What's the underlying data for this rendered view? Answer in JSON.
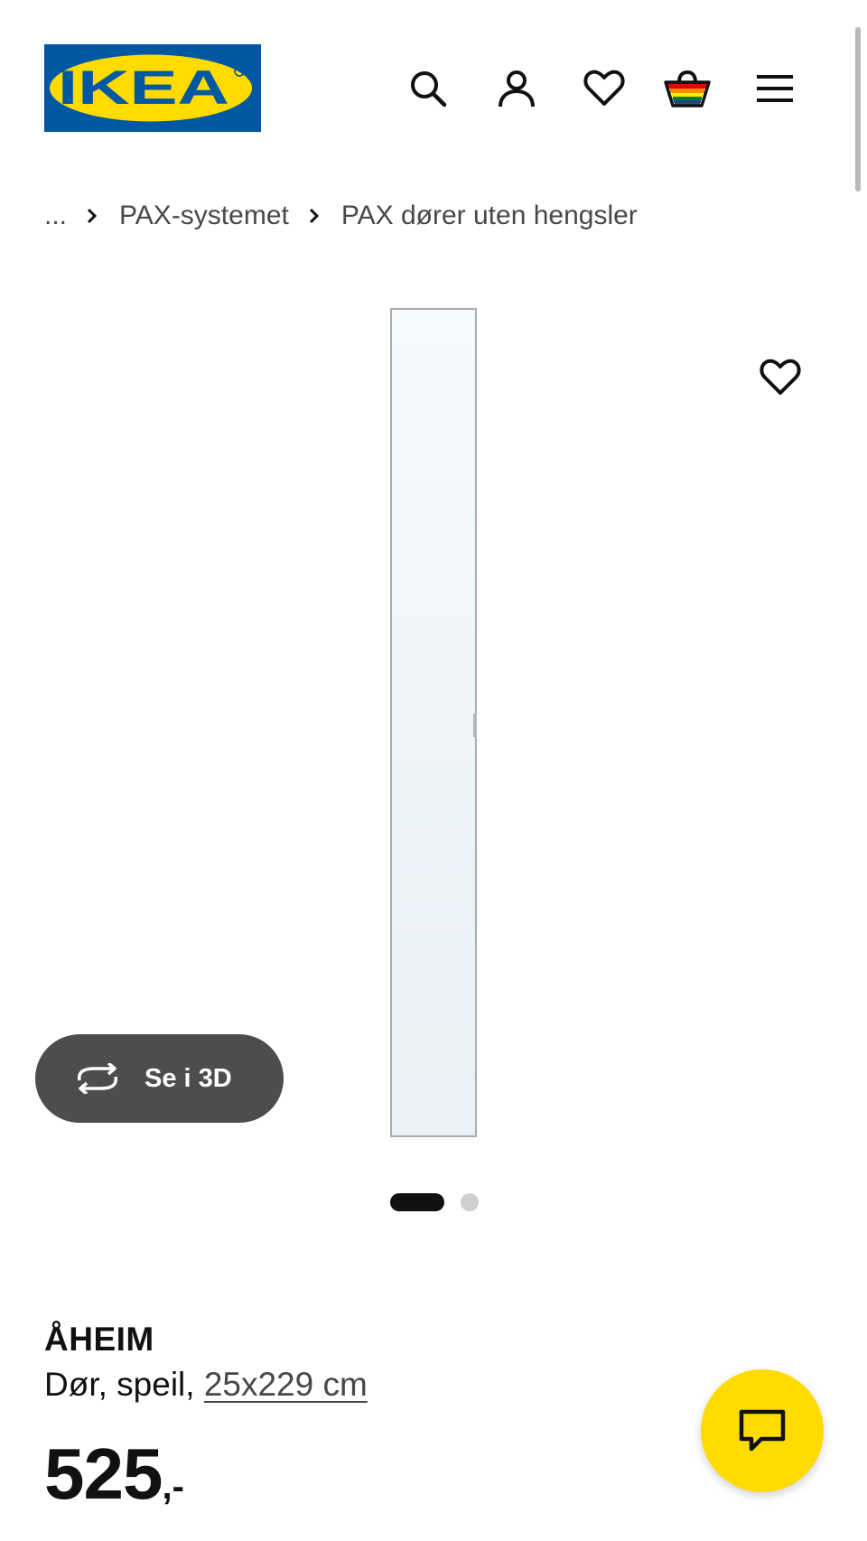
{
  "header": {
    "logo_text": "IKEA",
    "logo_colors": {
      "background": "#0058a3",
      "oval": "#ffdb00"
    },
    "icons": [
      "search-icon",
      "account-icon",
      "heart-icon",
      "basket-icon",
      "menu-icon"
    ]
  },
  "breadcrumb": {
    "ellipsis": "...",
    "items": [
      "PAX-systemet",
      "PAX dører uten hengsler"
    ]
  },
  "gallery": {
    "view_3d_label": "Se i 3D",
    "slide_count": 2,
    "active_slide": 1
  },
  "product": {
    "name": "ÅHEIM",
    "description": "Dør, speil, ",
    "size": "25x229 cm",
    "price_integer": "525",
    "price_suffix": ",-"
  },
  "colors": {
    "accent_yellow": "#ffdb00",
    "dark_button": "#4d4d4d",
    "text": "#111111"
  }
}
